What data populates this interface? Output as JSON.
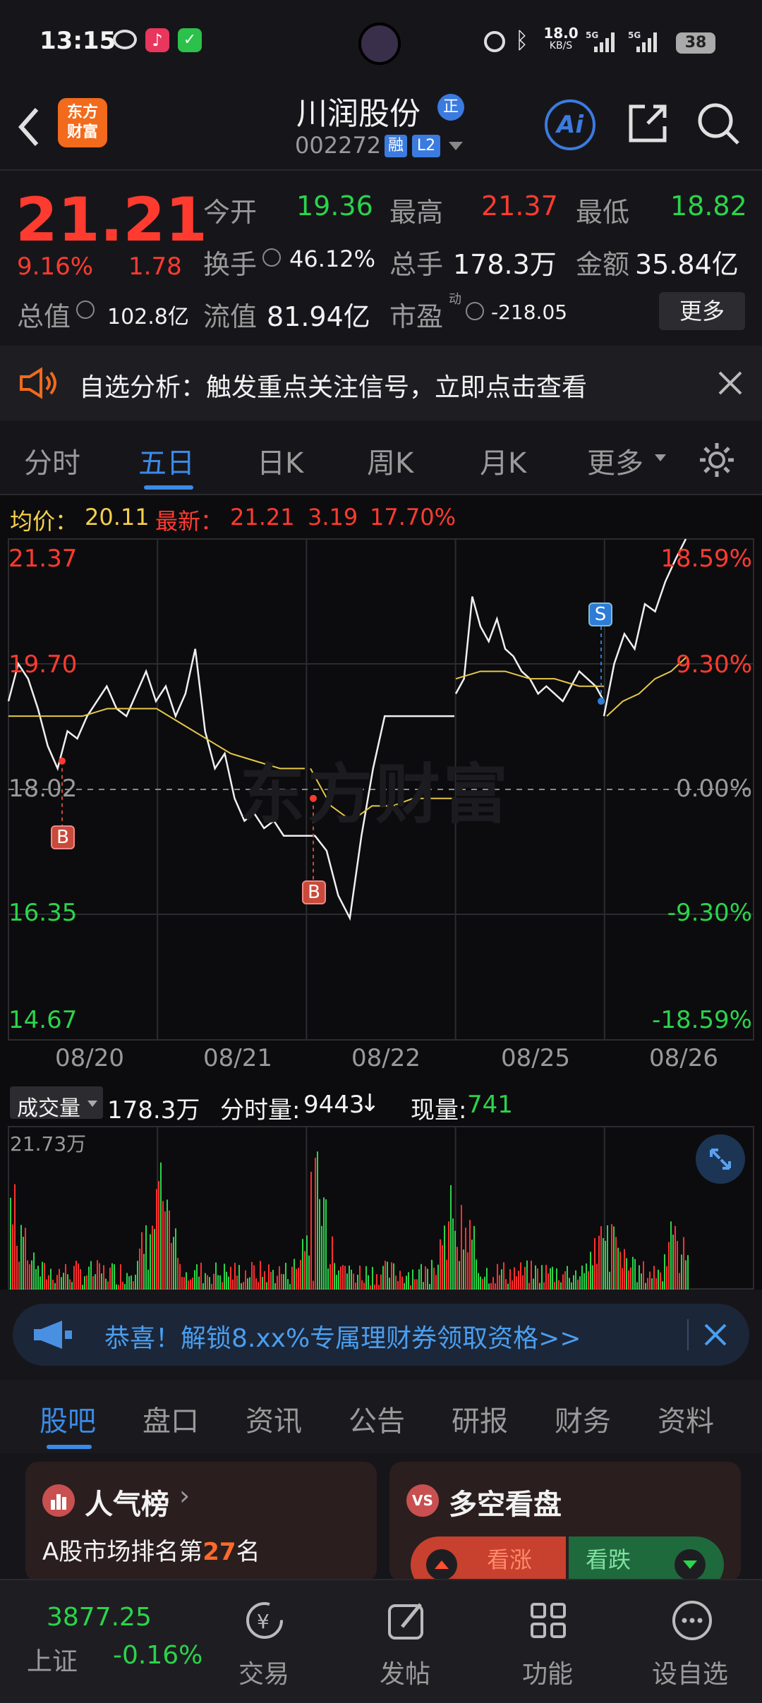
{
  "status_bar": {
    "time": "13:15",
    "net_speed_top": "18.0",
    "net_speed_unit": "KB/S",
    "battery": "38"
  },
  "header": {
    "logo_line1": "东方",
    "logo_line2": "财富",
    "stock_name": "川润股份",
    "badge": "正",
    "stock_code": "002272",
    "tag1": "融",
    "tag2": "L2",
    "ai_label": "Ai"
  },
  "quote": {
    "price": "21.21",
    "change_pct": "9.16%",
    "change": "1.78",
    "open_label": "今开",
    "open": "19.36",
    "high_label": "最高",
    "high": "21.37",
    "low_label": "最低",
    "low": "18.82",
    "turnover_label": "换手",
    "turnover": "46.12%",
    "volume_label": "总手",
    "volume": "178.3万",
    "amount_label": "金额",
    "amount": "35.84亿",
    "mcap_label": "总值",
    "mcap": "102.8亿",
    "float_label": "流值",
    "float": "81.94亿",
    "pe_label": "市盈",
    "pe_sup": "动",
    "pe": "-218.05",
    "more_button": "更多"
  },
  "notice": {
    "text": "自选分析：触发重点关注信号，立即点击查看"
  },
  "tabs": {
    "t1": "分时",
    "t2": "五日",
    "t3": "日K",
    "t4": "周K",
    "t5": "月K",
    "t6": "更多"
  },
  "chart_info": {
    "avg_label": "均价：",
    "avg_value": "20.11",
    "latest_label": "最新：",
    "latest": "21.21",
    "chg": "3.19",
    "chg_pct": "17.70%"
  },
  "chart_data": {
    "type": "line",
    "x_labels": [
      "08/20",
      "08/21",
      "08/22",
      "08/25",
      "08/26"
    ],
    "y_left_labels": [
      "21.37",
      "19.70",
      "18.02",
      "16.35",
      "14.67"
    ],
    "y_right_labels": [
      "18.59%",
      "9.30%",
      "0.00%",
      "-9.30%",
      "-18.59%"
    ],
    "ylim": [
      14.67,
      21.37
    ],
    "reference": 18.02,
    "markers": [
      {
        "label": "B",
        "day": "08/20"
      },
      {
        "label": "B",
        "day": "08/21"
      },
      {
        "label": "S",
        "day": "08/25"
      }
    ],
    "watermark": "东方财富",
    "colors": {
      "price": "#f0f0f0",
      "avg": "#e6c84a",
      "up": "#ff3030",
      "down": "#2bd44a"
    }
  },
  "volume": {
    "dropdown": "成交量",
    "total": "178.3万",
    "tick_label": "分时量:",
    "tick": "9443",
    "current_label": "现量:",
    "current": "741",
    "max_label": "21.73万"
  },
  "banner": {
    "text": "恭喜！解锁8.xx%专属理财券领取资格>>"
  },
  "sub_tabs": {
    "s1": "股吧",
    "s2": "盘口",
    "s3": "资讯",
    "s4": "公告",
    "s5": "研报",
    "s6": "财务",
    "s7": "资料"
  },
  "cards": {
    "left_title": "人气榜",
    "left_text_pre": "A股市场排名第",
    "left_rank": "27",
    "left_text_post": "名",
    "right_title": "多空看盘",
    "bull": "看涨",
    "bear": "看跌"
  },
  "bottom_nav": {
    "index_value": "3877.25",
    "index_name": "上证",
    "index_change": "-0.16%",
    "trade": "交易",
    "post": "发帖",
    "function": "功能",
    "watchlist": "设自选"
  }
}
